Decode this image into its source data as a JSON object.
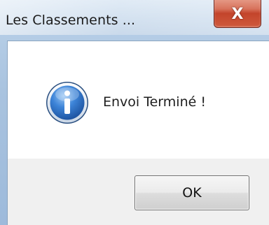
{
  "window": {
    "title": "Les Classements ...",
    "close_glyph": "X",
    "close_icon": "close-icon"
  },
  "dialog": {
    "icon": "info-icon",
    "message": "Envoi Terminé !",
    "ok_label": "OK"
  },
  "colors": {
    "close_button": "#c3442b",
    "info_icon": "#2e6fc9",
    "content_bg": "#ffffff",
    "button_bar_bg": "#f0f0f0"
  }
}
